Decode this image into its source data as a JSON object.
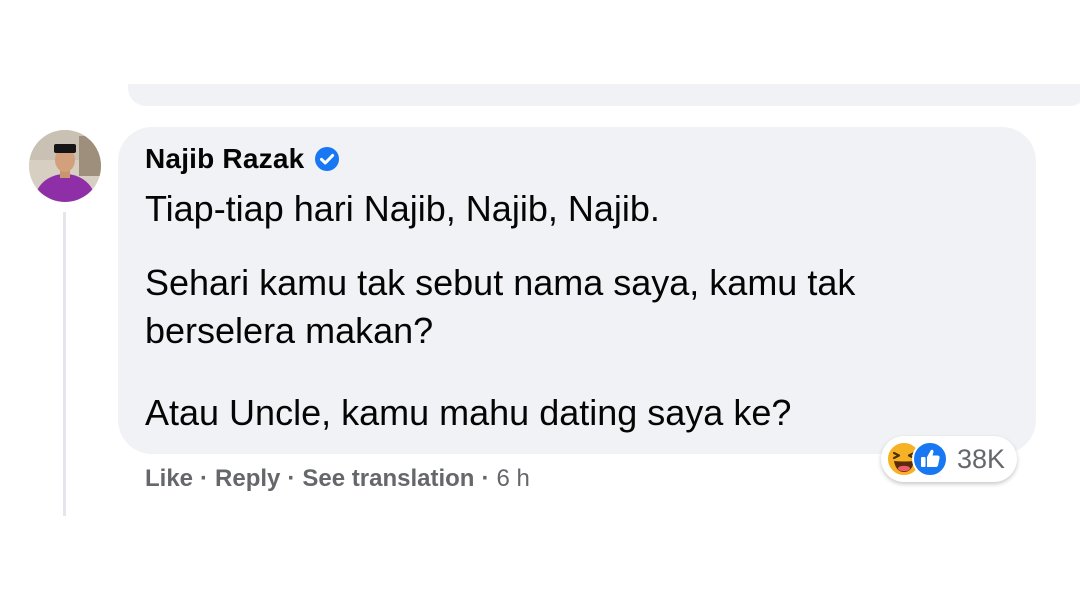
{
  "comment": {
    "author": "Najib Razak",
    "verified_icon": "verified-badge-icon",
    "lines": [
      "Tiap-tiap hari Najib, Najib, Najib.",
      "Sehari kamu tak sebut nama saya, kamu tak",
      "berselera makan?",
      "Atau Uncle, kamu mahu dating saya ke?"
    ],
    "actions": {
      "like": "Like",
      "reply": "Reply",
      "see_translation": "See translation",
      "separator": "·",
      "time": "6 h"
    },
    "reactions": {
      "icons": [
        "haha-icon",
        "like-icon"
      ],
      "count": "38K"
    }
  },
  "colors": {
    "bubble": "#f0f2f5",
    "secondary_text": "#65676b",
    "link_blue": "#1877f2",
    "haha_yellow": "#f7b125"
  }
}
